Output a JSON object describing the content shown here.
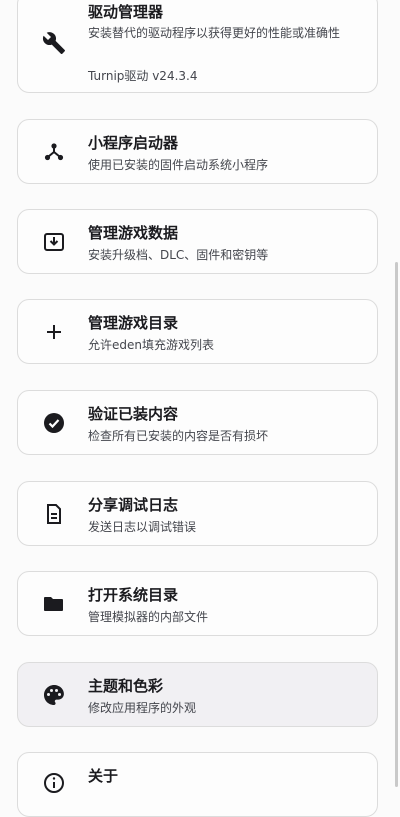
{
  "settings": {
    "items": [
      {
        "id": "driver-manager",
        "title": "驱动管理器",
        "description": "安装替代的驱动程序以获得更好的性能或准确性",
        "extra": "Turnip驱动  v24.3.4",
        "icon": "wrench-icon"
      },
      {
        "id": "applet-launcher",
        "title": "小程序启动器",
        "description": "使用已安装的固件启动系统小程序",
        "icon": "applet-icon"
      },
      {
        "id": "manage-game-data",
        "title": "管理游戏数据",
        "description": "安装升级档、DLC、固件和密钥等",
        "icon": "install-icon"
      },
      {
        "id": "manage-game-dirs",
        "title": "管理游戏目录",
        "description": "允许eden填充游戏列表",
        "icon": "plus-icon"
      },
      {
        "id": "verify-content",
        "title": "验证已装内容",
        "description": "检查所有已安装的内容是否有损坏",
        "icon": "check-circle-icon"
      },
      {
        "id": "share-log",
        "title": "分享调试日志",
        "description": "发送日志以调试错误",
        "icon": "document-icon"
      },
      {
        "id": "open-system-dir",
        "title": "打开系统目录",
        "description": "管理模拟器的内部文件",
        "icon": "folder-icon"
      },
      {
        "id": "theme-color",
        "title": "主题和色彩",
        "description": "修改应用程序的外观",
        "icon": "palette-icon"
      },
      {
        "id": "about",
        "title": "关于",
        "icon": "info-icon"
      }
    ]
  },
  "colors": {
    "background": "#fbfbfb",
    "card_border": "#dcdcdc",
    "card_highlight": "#f1f0f3",
    "title": "#1b1b1f",
    "description": "#44464d"
  }
}
